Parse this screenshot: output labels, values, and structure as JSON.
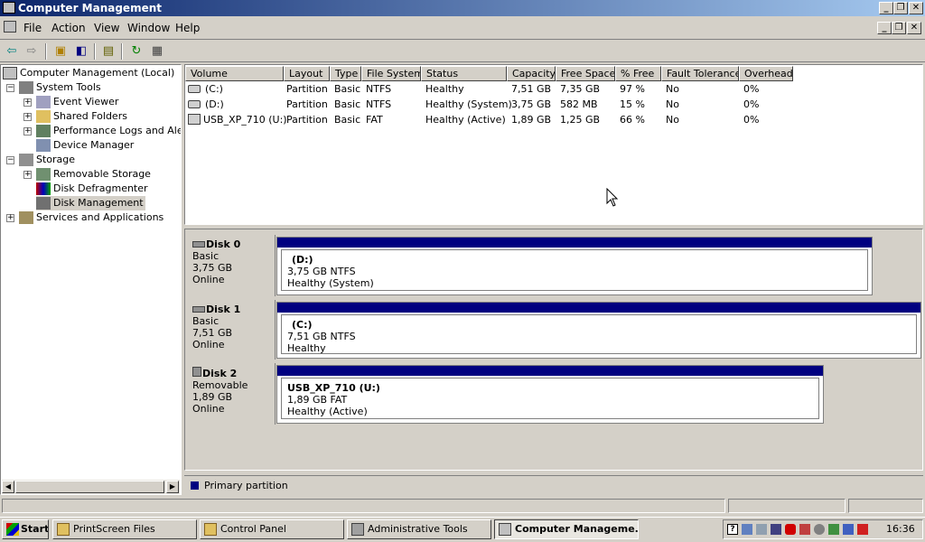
{
  "window": {
    "title": "Computer Management"
  },
  "menubar": {
    "items": [
      "File",
      "Action",
      "View",
      "Window",
      "Help"
    ]
  },
  "tree": {
    "root": "Computer Management (Local)",
    "system_tools": "System Tools",
    "event_viewer": "Event Viewer",
    "shared_folders": "Shared Folders",
    "perf_logs": "Performance Logs and Alerts",
    "device_manager": "Device Manager",
    "storage": "Storage",
    "removable_storage": "Removable Storage",
    "disk_defrag": "Disk Defragmenter",
    "disk_management": "Disk Management",
    "services_apps": "Services and Applications"
  },
  "volume_table": {
    "columns": [
      "Volume",
      "Layout",
      "Type",
      "File System",
      "Status",
      "Capacity",
      "Free Space",
      "% Free",
      "Fault Tolerance",
      "Overhead"
    ],
    "rows": [
      [
        "(C:)",
        "Partition",
        "Basic",
        "NTFS",
        "Healthy",
        "7,51 GB",
        "7,35 GB",
        "97 %",
        "No",
        "0%"
      ],
      [
        "(D:)",
        "Partition",
        "Basic",
        "NTFS",
        "Healthy (System)",
        "3,75 GB",
        "582 MB",
        "15 %",
        "No",
        "0%"
      ],
      [
        "USB_XP_710 (U:)",
        "Partition",
        "Basic",
        "FAT",
        "Healthy (Active)",
        "1,89 GB",
        "1,25 GB",
        "66 %",
        "No",
        "0%"
      ]
    ]
  },
  "disks": [
    {
      "name": "Disk 0",
      "type": "Basic",
      "size": "3,75 GB",
      "state": "Online",
      "part_name": "(D:)",
      "part_fs": "3,75 GB NTFS",
      "part_status": "Healthy (System)"
    },
    {
      "name": "Disk 1",
      "type": "Basic",
      "size": "7,51 GB",
      "state": "Online",
      "part_name": "(C:)",
      "part_fs": "7,51 GB NTFS",
      "part_status": "Healthy"
    },
    {
      "name": "Disk 2",
      "type": "Removable",
      "size": "1,89 GB",
      "state": "Online",
      "part_name": "USB_XP_710  (U:)",
      "part_fs": "1,89 GB FAT",
      "part_status": "Healthy (Active)"
    }
  ],
  "legend": {
    "label": "Primary partition",
    "color": "#000080"
  },
  "taskbar": {
    "start": "Start",
    "tasks": [
      "PrintScreen Files",
      "Control Panel",
      "Administrative Tools",
      "Computer Manageme..."
    ],
    "clock": "16:36"
  }
}
